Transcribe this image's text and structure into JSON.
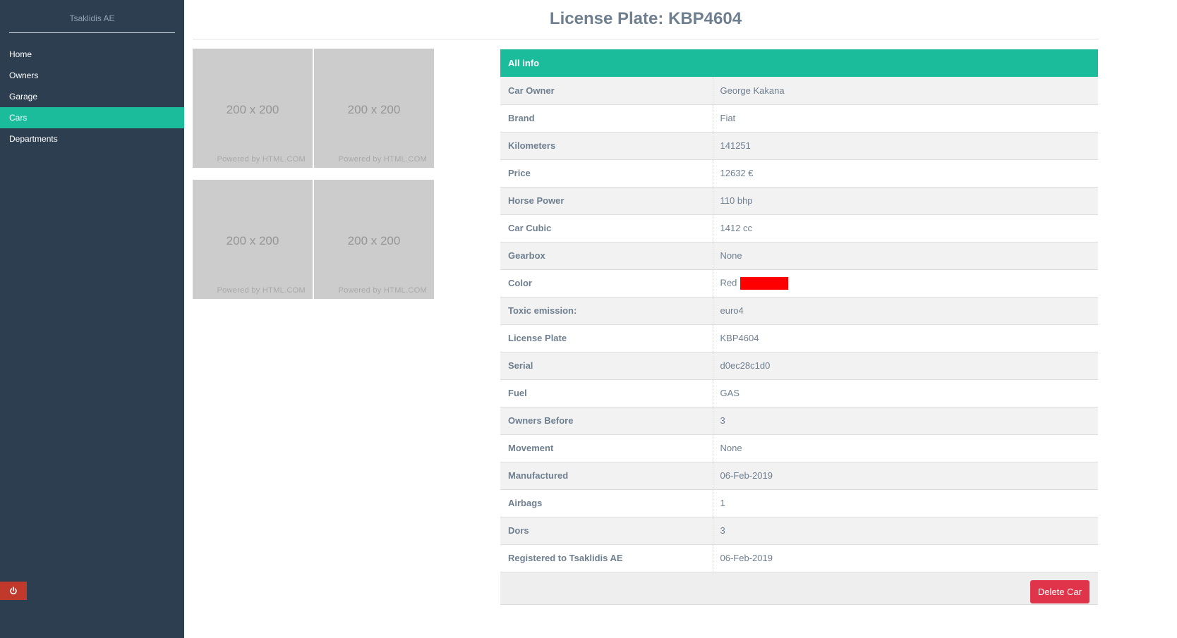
{
  "sidebar": {
    "brand": "Tsaklidis AE",
    "items": [
      {
        "label": "Home"
      },
      {
        "label": "Owners"
      },
      {
        "label": "Garage"
      },
      {
        "label": "Cars"
      },
      {
        "label": "Departments"
      }
    ],
    "active_item": "Cars",
    "power_icon": "power-icon"
  },
  "page": {
    "title": "License Plate: KBP4604"
  },
  "gallery": {
    "images": [
      {
        "dims": "200 x 200",
        "credit": "Powered by HTML.COM"
      },
      {
        "dims": "200 x 200",
        "credit": "Powered by HTML.COM"
      },
      {
        "dims": "200 x 200",
        "credit": "Powered by HTML.COM"
      },
      {
        "dims": "200 x 200",
        "credit": "Powered by HTML.COM"
      }
    ]
  },
  "info": {
    "header": "All info",
    "rows": [
      {
        "key": "Car Owner",
        "value": "George Kakana"
      },
      {
        "key": "Brand",
        "value": "Fiat"
      },
      {
        "key": "Kilometers",
        "value": "141251"
      },
      {
        "key": "Price",
        "value": "12632 €"
      },
      {
        "key": "Horse Power",
        "value": "110 bhp"
      },
      {
        "key": "Car Cubic",
        "value": "1412 cc"
      },
      {
        "key": "Gearbox",
        "value": "None"
      },
      {
        "key": "Color",
        "value": "Red"
      },
      {
        "key": "Toxic emission:",
        "value": "euro4"
      },
      {
        "key": "License Plate",
        "value": "KBP4604"
      },
      {
        "key": "Serial",
        "value": "d0ec28c1d0"
      },
      {
        "key": "Fuel",
        "value": "GAS"
      },
      {
        "key": "Owners Before",
        "value": "3"
      },
      {
        "key": "Movement",
        "value": "None"
      },
      {
        "key": "Manufactured",
        "value": "06-Feb-2019"
      },
      {
        "key": "Airbags",
        "value": "1"
      },
      {
        "key": "Dors",
        "value": "3"
      },
      {
        "key": "Registered to Tsaklidis AE",
        "value": "06-Feb-2019"
      }
    ],
    "color_swatch": "#ff0000"
  },
  "actions": {
    "delete_label": "Delete Car"
  },
  "colors": {
    "sidebar_bg": "#2c3e50",
    "accent": "#1abc9c",
    "danger": "#e0344a"
  }
}
